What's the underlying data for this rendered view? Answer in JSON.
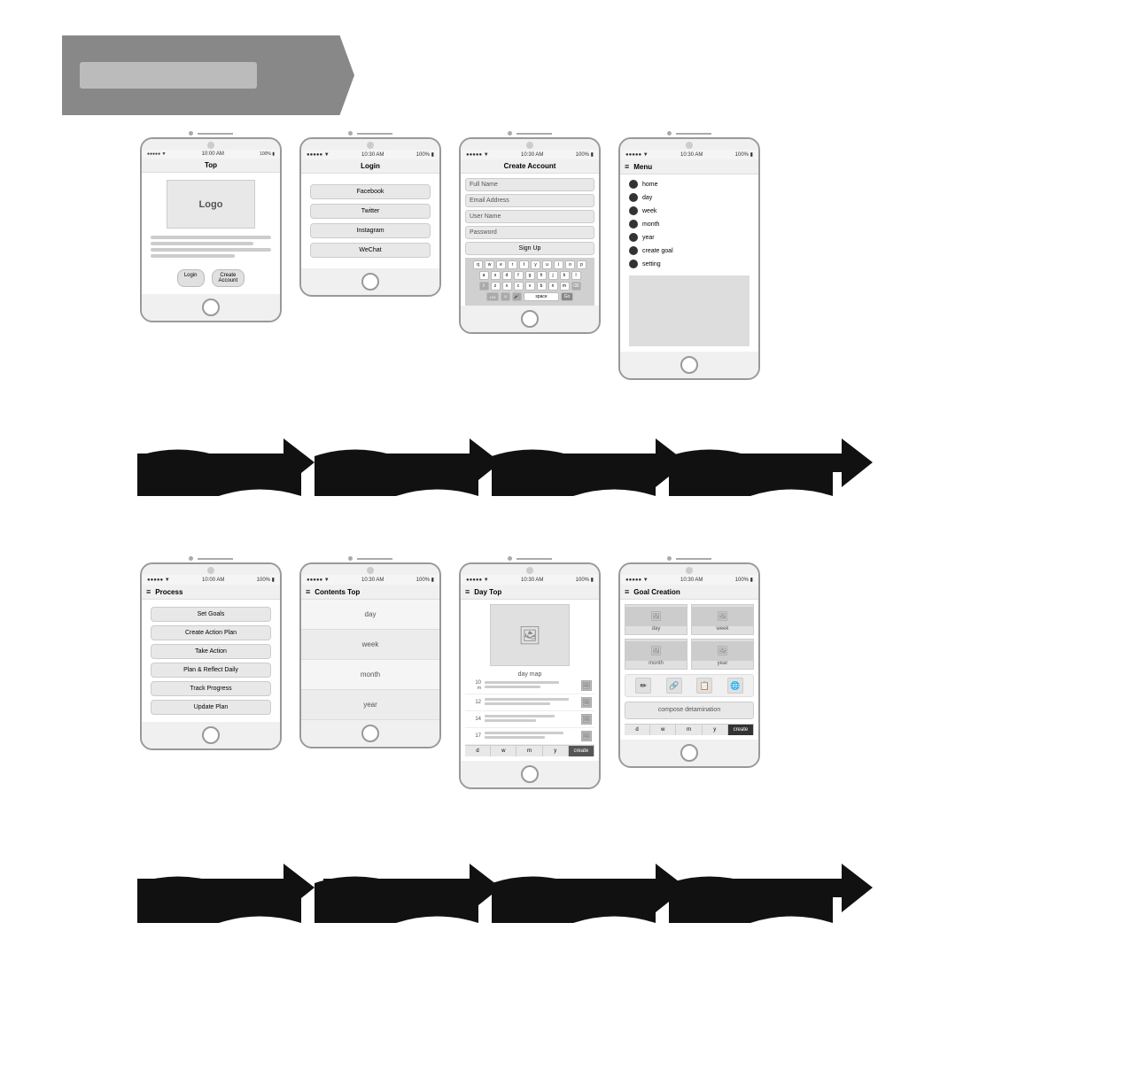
{
  "brand": {
    "logo_text": "Logo"
  },
  "row1": {
    "phones": [
      {
        "id": "top",
        "title": "Top",
        "status_left": "●●●●● ▼",
        "status_time": "10:00 AM",
        "status_right": "100% ▮",
        "type": "top"
      },
      {
        "id": "login",
        "title": "Login",
        "status_left": "●●●●● ▼",
        "status_time": "10:30 AM",
        "status_right": "100% ▮",
        "type": "login",
        "social_buttons": [
          "Facebook",
          "Twitter",
          "Instagram",
          "WeChat"
        ]
      },
      {
        "id": "create-account",
        "title": "Create Account",
        "status_left": "●●●●● ▼",
        "status_time": "10:30 AM",
        "status_right": "100% ▮",
        "type": "create-account",
        "fields": [
          "Full Name",
          "Email Address",
          "User Name",
          "Password",
          "Sign Up"
        ]
      },
      {
        "id": "menu",
        "title": "Menu",
        "status_left": "●●●●● ▼",
        "status_time": "10:30 AM",
        "status_right": "100% ▮",
        "type": "menu",
        "menu_items": [
          "home",
          "day",
          "week",
          "month",
          "year",
          "create goal",
          "setting"
        ]
      }
    ]
  },
  "row1_arrows": [
    {
      "label": ""
    },
    {
      "label": ""
    },
    {
      "label": ""
    }
  ],
  "row2": {
    "phones": [
      {
        "id": "process",
        "title": "Process",
        "status_left": "●●●●● ▼",
        "status_time": "10:00 AM",
        "status_right": "100% ▮",
        "type": "process",
        "buttons": [
          "Set Goals",
          "Create Action Plan",
          "Take Action",
          "Plan & Reflect Daily",
          "Track Progress",
          "Update Plan"
        ]
      },
      {
        "id": "contents-top",
        "title": "Contents Top",
        "status_left": "●●●●● ▼",
        "status_time": "10:30 AM",
        "status_right": "100% ▮",
        "type": "contents-top",
        "sections": [
          "day",
          "week",
          "month",
          "year"
        ]
      },
      {
        "id": "day-top",
        "title": "Day Top",
        "status_left": "●●●●● ▼",
        "status_time": "10:30 AM",
        "status_right": "100% ▮",
        "type": "day-top",
        "map_label": "day map",
        "list_items": [
          {
            "num": "10",
            "sub": "m"
          },
          {
            "num": "12"
          },
          {
            "num": "14"
          },
          {
            "num": "17"
          }
        ],
        "bottom_btns": [
          "d",
          "w",
          "m",
          "y",
          "create"
        ]
      },
      {
        "id": "goal-creation",
        "title": "Goal Creation",
        "status_left": "●●●●● ▼",
        "status_time": "10:30 AM",
        "status_right": "100% ▮",
        "type": "goal-creation",
        "grid_labels": [
          "day",
          "week",
          "month",
          "year"
        ],
        "action_icons": [
          "✏️",
          "🔗",
          "📅",
          "🌐"
        ],
        "compose_label": "compose detamination",
        "bottom_btns": [
          "d",
          "w",
          "m",
          "y",
          "create"
        ]
      }
    ]
  },
  "row2_arrows": [
    {
      "label": ""
    },
    {
      "label": ""
    },
    {
      "label": ""
    }
  ]
}
